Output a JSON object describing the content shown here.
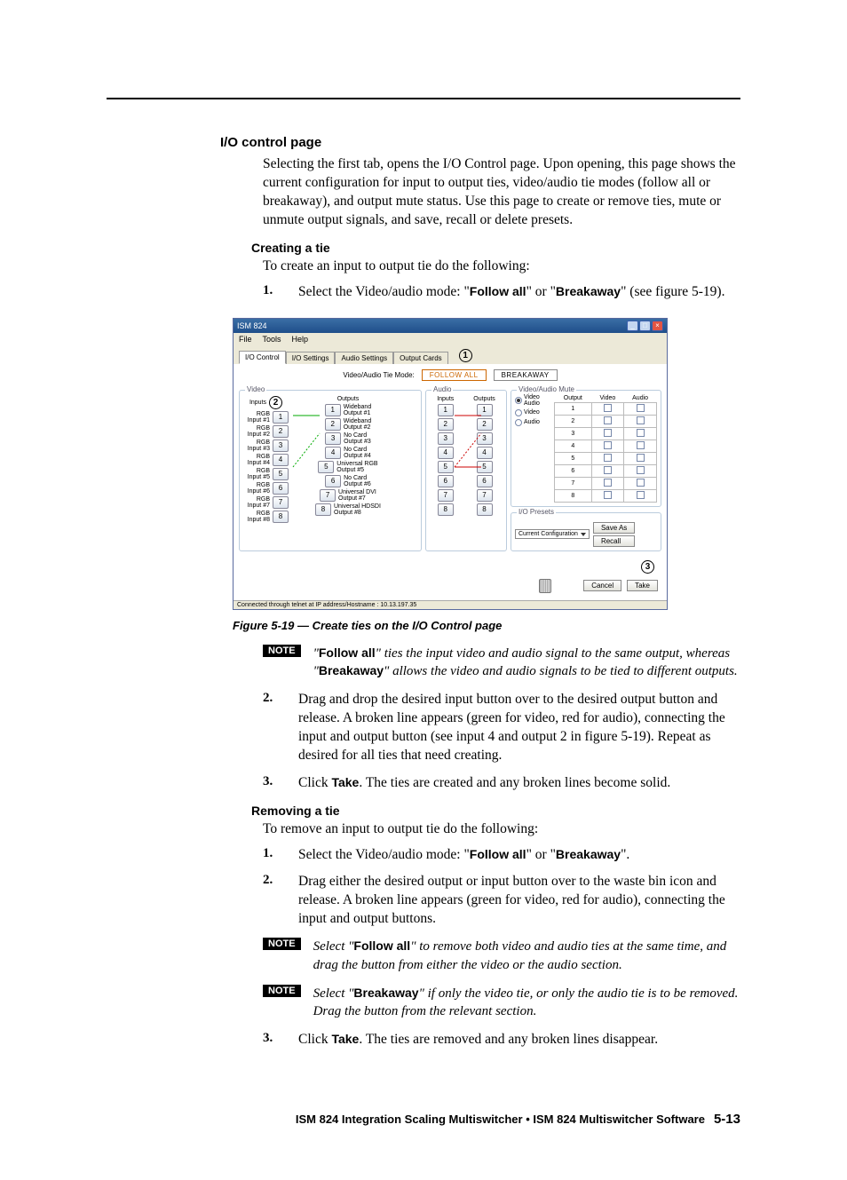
{
  "section": {
    "heading": "I/O control page",
    "intro": "Selecting the first tab, opens the I/O Control page.  Upon opening, this page shows the current configuration for input to output ties, video/audio tie modes (follow all or breakaway), and output mute status.  Use this page to create or remove ties, mute or unmute output signals, and save, recall or delete presets."
  },
  "creating": {
    "heading": "Creating a tie",
    "intro": "To create an input to output tie do the following:",
    "step1_num": "1.",
    "step1_a": "Select the Video/audio mode: \"",
    "step1_b": "Follow all",
    "step1_c": "\" or \"",
    "step1_d": "Breakaway",
    "step1_e": "\" (see figure 5-19).",
    "step2_num": "2.",
    "step2": "Drag and drop the desired input button over to the desired output button and release.  A broken line appears (green for video, red for audio), connecting the input and output button (see input 4 and output 2 in figure 5-19).  Repeat as desired for all ties that need creating.",
    "step3_num": "3.",
    "step3_a": "Click ",
    "step3_b": "Take",
    "step3_c": ".  The ties are created and any broken lines become solid."
  },
  "caption": "Figure 5-19 — Create ties on the I/O Control page",
  "note1": {
    "label": "NOTE",
    "a": "\"",
    "b": "Follow all",
    "c": "\" ties the input video and audio signal to the same output, whereas \"",
    "d": "Breakaway",
    "e": "\" allows the video and audio signals to be tied to different outputs."
  },
  "removing": {
    "heading": "Removing a tie",
    "intro": "To remove an input to output tie do the following:",
    "step1_num": "1.",
    "step1_a": "Select the Video/audio mode: \"",
    "step1_b": "Follow all",
    "step1_c": "\" or \"",
    "step1_d": "Breakaway",
    "step1_e": "\".",
    "step2_num": "2.",
    "step2": "Drag either the desired output or input button over to the waste bin icon and release.  A broken line appears (green for video, red for audio), connecting the input and output buttons.",
    "step3_num": "3.",
    "step3_a": "Click ",
    "step3_b": "Take",
    "step3_c": ".  The ties are removed and any broken lines disappear."
  },
  "note2": {
    "label": "NOTE",
    "a": "Select \"",
    "b": "Follow all",
    "c": "\" to remove both video and audio ties at the same time, and drag the button from either the video or the audio section."
  },
  "note3": {
    "label": "NOTE",
    "a": "Select \"",
    "b": "Breakaway",
    "c": "\" if only the video tie, or only the audio tie is to be removed.  Drag the button from the relevant section."
  },
  "footer": {
    "text": "ISM 824 Integration Scaling Multiswitcher • ISM 824 Multiswitcher Software",
    "page": "5-13"
  },
  "shot": {
    "title": "ISM 824",
    "menu": {
      "file": "File",
      "tools": "Tools",
      "help": "Help"
    },
    "tabs": {
      "t1": "I/O Control",
      "t2": "I/O Settings",
      "t3": "Audio Settings",
      "t4": "Output Cards"
    },
    "mode_label": "Video/Audio Tie Mode:",
    "follow_all": "FOLLOW ALL",
    "breakaway": "BREAKAWAY",
    "video_group": "Video",
    "audio_group": "Audio",
    "mute_group": "Video/Audio Mute",
    "preset_group": "I/O Presets",
    "inputs_label": "Inputs",
    "outputs_label": "Outputs",
    "video_inputs": [
      {
        "t": "RGB",
        "s": "Input #1"
      },
      {
        "t": "RGB",
        "s": "Input #2"
      },
      {
        "t": "RGB",
        "s": "Input #3"
      },
      {
        "t": "RGB",
        "s": "Input #4"
      },
      {
        "t": "RGB",
        "s": "Input #5"
      },
      {
        "t": "RGB",
        "s": "Input #6"
      },
      {
        "t": "RGB",
        "s": "Input #7"
      },
      {
        "t": "RGB",
        "s": "Input #8"
      }
    ],
    "video_outputs": [
      {
        "t": "Wideband",
        "s": "Output #1"
      },
      {
        "t": "Wideband",
        "s": "Output #2"
      },
      {
        "t": "No Card",
        "s": "Output #3"
      },
      {
        "t": "No Card",
        "s": "Output #4"
      },
      {
        "t": "Universal RGB",
        "s": "Output #5"
      },
      {
        "t": "No Card",
        "s": "Output #6"
      },
      {
        "t": "Universal DVI",
        "s": "Output #7"
      },
      {
        "t": "Universal HDSDI",
        "s": "Output #8"
      }
    ],
    "mute_head": {
      "out": "Output",
      "v": "Video",
      "a": "Audio"
    },
    "mute_radios": {
      "va": "Video Audio",
      "v": "Video",
      "a": "Audio"
    },
    "preset_sel": "Current Configuration",
    "saveas": "Save As",
    "recall": "Recall",
    "cancel": "Cancel",
    "take": "Take",
    "status": "Connected through telnet at IP address/Hostname : 10.13.197.35",
    "callout1": "1",
    "callout2": "2",
    "callout3": "3"
  }
}
